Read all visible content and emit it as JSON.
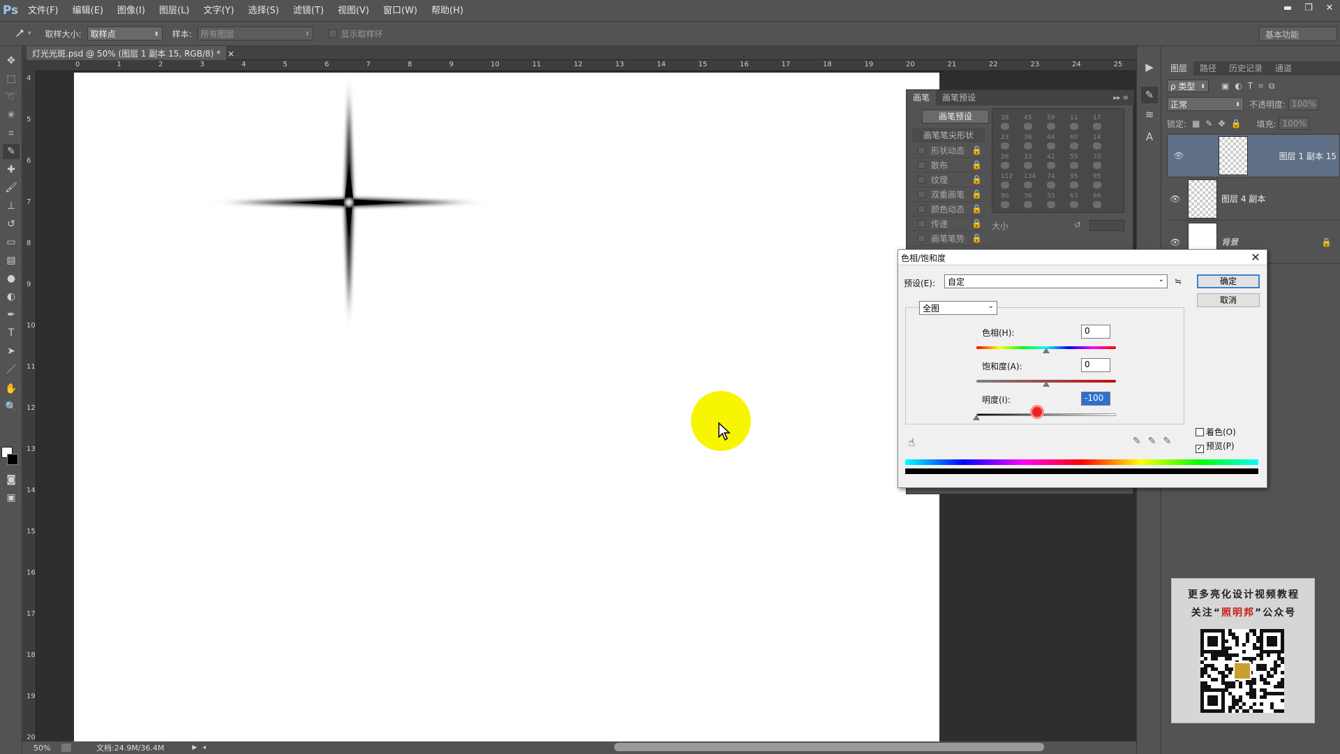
{
  "app": {
    "logo": "Ps"
  },
  "menu": [
    "文件(F)",
    "编辑(E)",
    "图像(I)",
    "图层(L)",
    "文字(Y)",
    "选择(S)",
    "滤镜(T)",
    "视图(V)",
    "窗口(W)",
    "帮助(H)"
  ],
  "window_controls": {
    "minimize": "▬",
    "restore": "❐",
    "close": "✕"
  },
  "options_bar": {
    "sample_size_label": "取样大小:",
    "sample_size_value": "取样点",
    "sample_label": "样本:",
    "sample_value": "所有图层",
    "show_ring_label": "显示取样环",
    "workspace": "基本功能"
  },
  "document": {
    "tab_title": "灯光光斑.psd @ 50% (图层 1 副本 15, RGB/8) *",
    "tab_close": "×",
    "zoom": "50%",
    "doc_info": "文档:24.9M/36.4M",
    "ruler_top": [
      "0",
      "1",
      "2",
      "3",
      "4",
      "5",
      "6",
      "7",
      "8",
      "9",
      "10",
      "11",
      "12",
      "13",
      "14",
      "15",
      "16",
      "17",
      "18",
      "19",
      "20",
      "21",
      "22",
      "23",
      "24",
      "25"
    ],
    "ruler_left": [
      "4",
      "5",
      "6",
      "7",
      "8",
      "9",
      "10",
      "11",
      "12",
      "13",
      "14",
      "15",
      "16",
      "17",
      "18",
      "19",
      "20"
    ]
  },
  "brush_panel": {
    "tabs": [
      "画笔",
      "画笔预设"
    ],
    "preset_button": "画笔预设",
    "items": [
      "画笔笔尖形状",
      "形状动态",
      "散布",
      "纹理",
      "双重画笔",
      "颜色动态",
      "传递",
      "画笔笔势"
    ],
    "grid_numbers": [
      "38",
      "45",
      "59",
      "11",
      "17",
      "23",
      "36",
      "44",
      "60",
      "14",
      "26",
      "33",
      "42",
      "55",
      "70",
      "112",
      "134",
      "74",
      "95",
      "95",
      "90",
      "36",
      "33",
      "63",
      "66"
    ],
    "size_label": "大小"
  },
  "layers_panel": {
    "tabs": [
      "图层",
      "路径",
      "历史记录",
      "通道"
    ],
    "kind_filter": "ρ 类型",
    "blend_mode": "正常",
    "opacity_label": "不透明度:",
    "opacity_value": "100%",
    "lock_label": "锁定:",
    "fill_label": "填充:",
    "fill_value": "100%",
    "layers": [
      {
        "name": "图层 1 副本 15",
        "selected": true
      },
      {
        "name": "图层 4 副本",
        "selected": false
      },
      {
        "name": "背景",
        "selected": false
      }
    ]
  },
  "dialog": {
    "title": "色相/饱和度",
    "preset_label": "预设(E):",
    "preset_value": "自定",
    "ok": "确定",
    "cancel": "取消",
    "range_value": "全图",
    "hue_label": "色相(H):",
    "hue_value": "0",
    "saturation_label": "饱和度(A):",
    "saturation_value": "0",
    "lightness_label": "明度(I):",
    "lightness_value": "-100",
    "colorize_label": "着色(O)",
    "preview_label": "预览(P)",
    "colorize_checked": false,
    "preview_checked": true
  },
  "promo": {
    "line1": "更多亮化设计视频教程",
    "line2_prefix": "关注“",
    "line2_brand": "照明邦",
    "line2_suffix": "”公众号"
  },
  "icons": {
    "eyedropper": "eyedropper-icon",
    "eye": "eye-icon",
    "lock": "lock-icon",
    "hand": "hand-icon"
  },
  "colors": {
    "panel_bg": "#535353",
    "canvas": "#ffffff",
    "selected_layer": "#5f6f86",
    "cursor_highlight": "#f7f500",
    "dialog_primary_border": "#3c7fd7"
  }
}
